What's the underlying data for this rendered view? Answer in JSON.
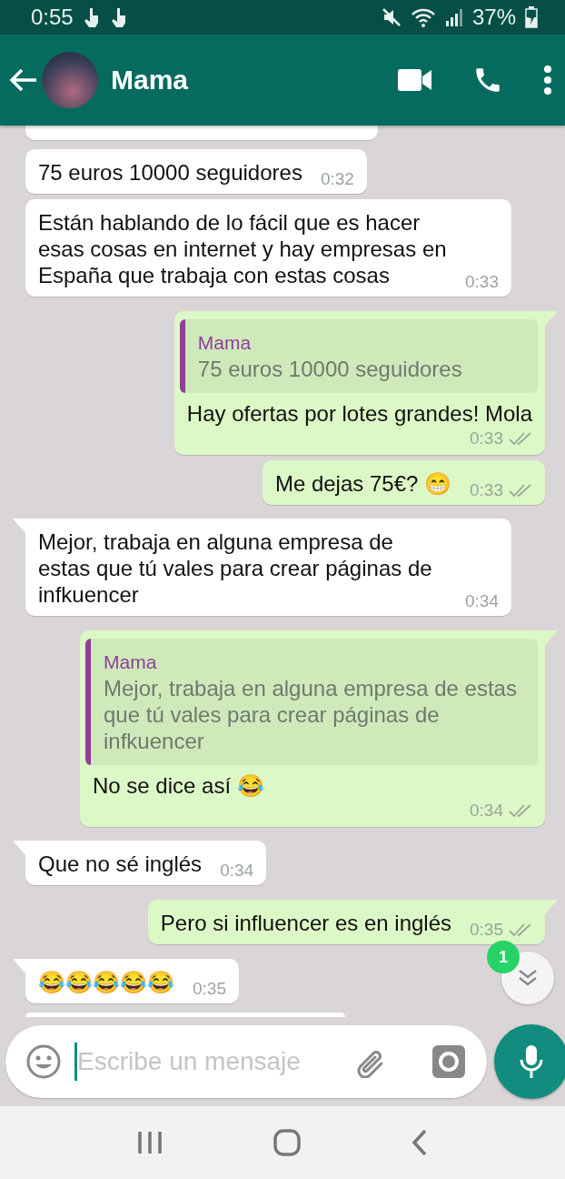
{
  "status_bar": {
    "time": "0:55",
    "battery": "37%"
  },
  "header": {
    "contact_name": "Mama"
  },
  "messages": [
    {
      "kind": "incoming",
      "tail": false,
      "text": "75 euros 10000 seguidores",
      "time": "0:32"
    },
    {
      "kind": "incoming",
      "tail": false,
      "text": "Están hablando de lo fácil que es hacer esas cosas en internet y hay empresas en España que trabaja con estas cosas",
      "time": "0:33"
    },
    {
      "kind": "outgoing",
      "tail": true,
      "quote": {
        "author": "Mama",
        "text": "75 euros 10000 seguidores"
      },
      "text": "Hay ofertas por lotes grandes! Mola",
      "time": "0:33",
      "read": false
    },
    {
      "kind": "outgoing",
      "tail": false,
      "text": "Me dejas 75€? 😁",
      "time": "0:33",
      "read": false
    },
    {
      "kind": "incoming",
      "tail": true,
      "text": "Mejor, trabaja en alguna empresa de estas que tú vales para crear páginas de infkuencer",
      "time": "0:34"
    },
    {
      "kind": "outgoing",
      "tail": true,
      "quote": {
        "author": "Mama",
        "text": "Mejor, trabaja en alguna empresa de estas que tú vales para crear páginas de infkuencer"
      },
      "text": "No se dice así 😂",
      "time": "0:34",
      "read": false
    },
    {
      "kind": "incoming",
      "tail": true,
      "text": "Que no sé inglés",
      "time": "0:34"
    },
    {
      "kind": "outgoing",
      "tail": true,
      "text": "Pero si influencer es en inglés",
      "time": "0:35",
      "read": false
    },
    {
      "kind": "incoming",
      "tail": true,
      "text": "😂😂😂😂😂",
      "time": "0:35"
    }
  ],
  "scroll_button": {
    "unread_count": "1"
  },
  "composer": {
    "placeholder": "Escribe un mensaje"
  }
}
